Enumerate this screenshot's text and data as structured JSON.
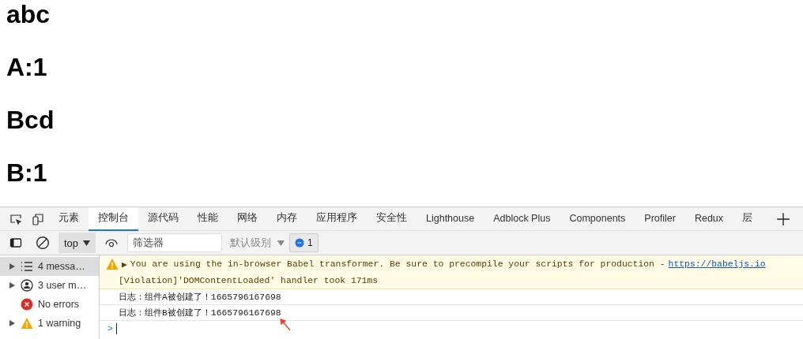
{
  "page": {
    "headings": [
      "abc",
      "A:1",
      "Bcd",
      "B:1"
    ]
  },
  "devtools": {
    "tabs": [
      {
        "label": "元素",
        "selected": false
      },
      {
        "label": "控制台",
        "selected": true
      },
      {
        "label": "源代码",
        "selected": false
      },
      {
        "label": "性能",
        "selected": false
      },
      {
        "label": "网络",
        "selected": false
      },
      {
        "label": "内存",
        "selected": false
      },
      {
        "label": "应用程序",
        "selected": false
      },
      {
        "label": "安全性",
        "selected": false
      },
      {
        "label": "Lighthouse",
        "selected": false
      },
      {
        "label": "Adblock Plus",
        "selected": false
      },
      {
        "label": "Components",
        "selected": false
      },
      {
        "label": "Profiler",
        "selected": false
      },
      {
        "label": "Redux",
        "selected": false
      },
      {
        "label": "层",
        "selected": false
      }
    ],
    "toolbar": {
      "context": "top",
      "filter": {
        "placeholder": "筛选器"
      },
      "level": "默认级别",
      "issues_count": "1"
    },
    "sidebar": {
      "items": [
        {
          "kind": "messages",
          "label": "4 messa…",
          "expandable": true,
          "selected": true
        },
        {
          "kind": "user",
          "label": "3 user m…",
          "expandable": true,
          "selected": false
        },
        {
          "kind": "errors",
          "label": "No errors",
          "expandable": false,
          "selected": false
        },
        {
          "kind": "warnings",
          "label": "1 warning",
          "expandable": true,
          "selected": false
        }
      ]
    },
    "console": {
      "messages": [
        {
          "kind": "warning",
          "arrow": "▶",
          "text": "You are using the in-browser Babel transformer. Be sure to precompile your scripts for production - ",
          "link": "https://babeljs.io"
        },
        {
          "kind": "violation",
          "text": "[Violation]'DOMContentLoaded' handler took 171ms"
        },
        {
          "kind": "log",
          "text": "日志：组件A被创建了！1665796167698"
        },
        {
          "kind": "log",
          "text": "日志：组件B被创建了！1665796167698"
        }
      ],
      "prompt": ">"
    }
  }
}
